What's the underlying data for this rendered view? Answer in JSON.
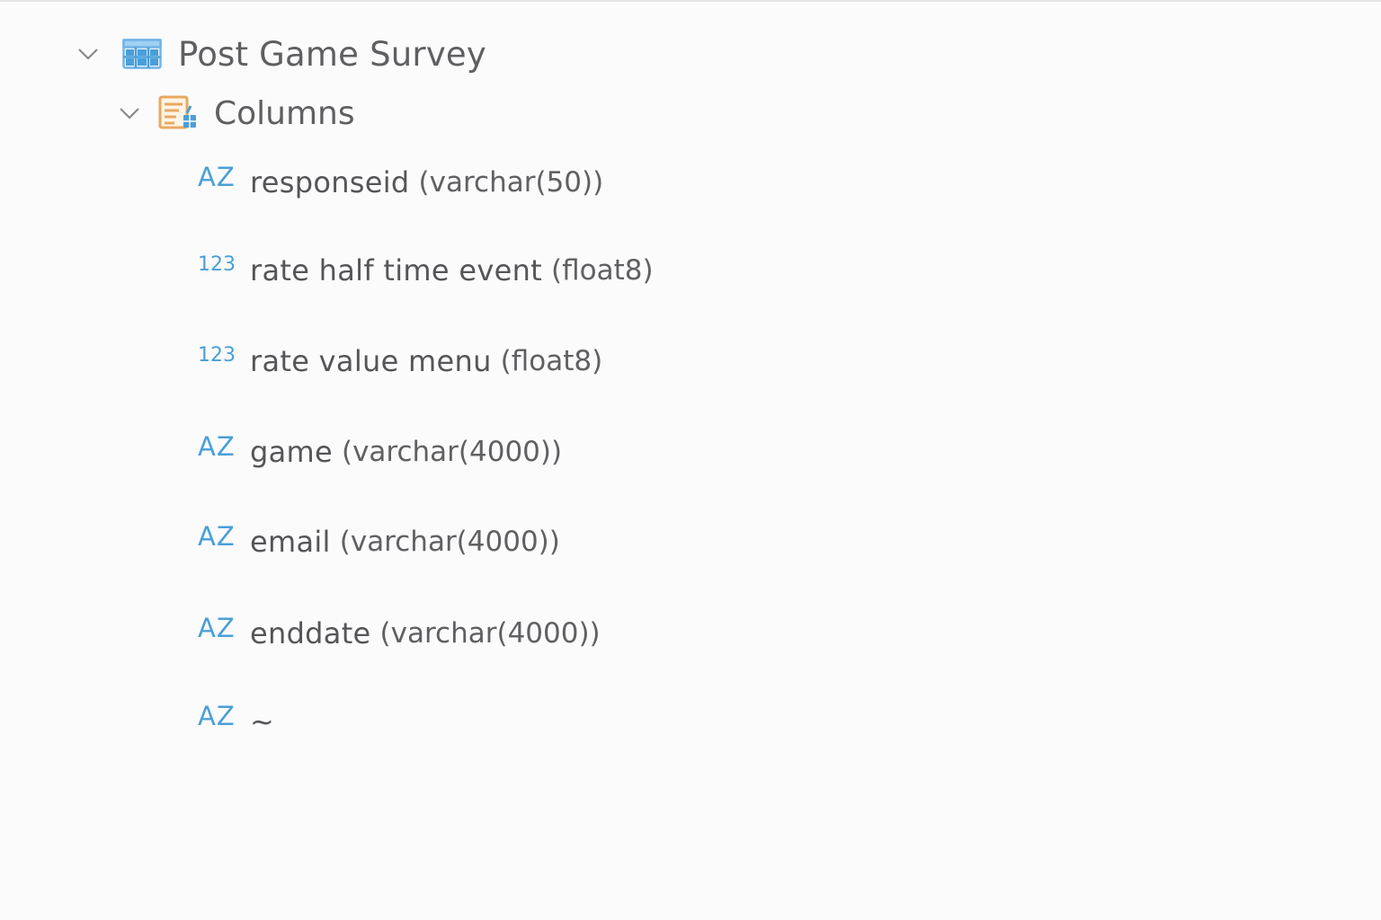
{
  "table": {
    "name": "Post Game Survey",
    "icon": "table-icon"
  },
  "columns_folder": {
    "label": "Columns",
    "icon": "columns-folder-icon"
  },
  "columns": [
    {
      "type_icon": "AZ",
      "name": "responseid",
      "datatype": "(varchar(50))"
    },
    {
      "type_icon": "123",
      "name": "rate half time event",
      "datatype": "(float8)"
    },
    {
      "type_icon": "123",
      "name": "rate value menu",
      "datatype": "(float8)"
    },
    {
      "type_icon": "AZ",
      "name": "game",
      "datatype": "(varchar(4000))"
    },
    {
      "type_icon": "AZ",
      "name": "email",
      "datatype": "(varchar(4000))"
    },
    {
      "type_icon": "AZ",
      "name": "enddate",
      "datatype": "(varchar(4000))"
    },
    {
      "type_icon": "AZ",
      "name": "~",
      "datatype": ""
    }
  ],
  "colors": {
    "accent_blue": "#4a9fd8",
    "folder_orange": "#e8a860",
    "text_gray": "#5f5f62"
  }
}
